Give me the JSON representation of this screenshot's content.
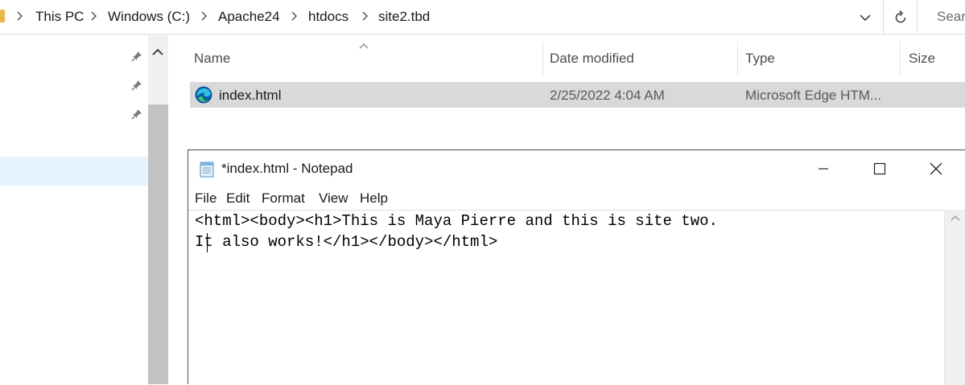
{
  "address_bar": {
    "breadcrumbs": [
      "This PC",
      "Windows (C:)",
      "Apache24",
      "htdocs",
      "site2.tbd"
    ],
    "search_placeholder": "Sear"
  },
  "file_list": {
    "columns": [
      "Name",
      "Date modified",
      "Type",
      "Size"
    ],
    "rows": [
      {
        "name": "index.html",
        "date_modified": "2/25/2022 4:04 AM",
        "type": "Microsoft Edge HTM...",
        "size": "",
        "icon": "edge-icon"
      }
    ]
  },
  "notepad": {
    "title": "*index.html - Notepad",
    "menu": [
      "File",
      "Edit",
      "Format",
      "View",
      "Help"
    ],
    "lines": [
      "<html><body><h1>This is Maya Pierre and this is site two.",
      "It also works!</h1></body></html>"
    ]
  },
  "colors": {
    "selected_row": "#d9d9d9",
    "nav_selected": "#e5f3ff",
    "folder": "#e8b84a"
  }
}
